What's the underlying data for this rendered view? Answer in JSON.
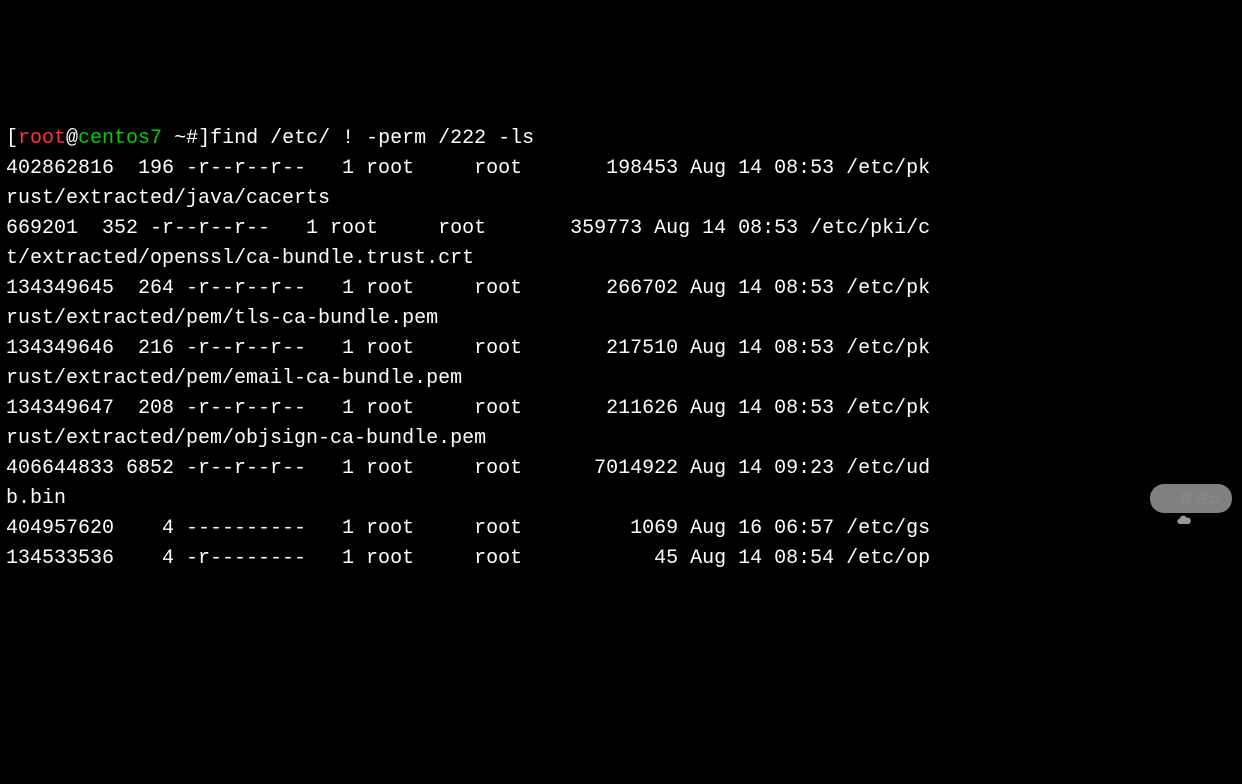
{
  "prompt": {
    "open_bracket": "[",
    "user": "root",
    "at": "@",
    "host": "centos7",
    "space": " ",
    "tilde": "~#",
    "close_bracket": "]",
    "command": "find /etc/ ! -perm /222 -ls"
  },
  "lines": {
    "l1": "402862816  196 -r--r--r--   1 root     root       198453 Aug 14 08:53 /etc/pk",
    "l2": "rust/extracted/java/cacerts",
    "l3": "669201  352 -r--r--r--   1 root     root       359773 Aug 14 08:53 /etc/pki/c",
    "l4": "t/extracted/openssl/ca-bundle.trust.crt",
    "l5": "134349645  264 -r--r--r--   1 root     root       266702 Aug 14 08:53 /etc/pk",
    "l6": "rust/extracted/pem/tls-ca-bundle.pem",
    "l7": "134349646  216 -r--r--r--   1 root     root       217510 Aug 14 08:53 /etc/pk",
    "l8": "rust/extracted/pem/email-ca-bundle.pem",
    "l9": "134349647  208 -r--r--r--   1 root     root       211626 Aug 14 08:53 /etc/pk",
    "l10": "rust/extracted/pem/objsign-ca-bundle.pem",
    "l11": "406644833 6852 -r--r--r--   1 root     root      7014922 Aug 14 09:23 /etc/ud",
    "l12": "b.bin",
    "l13": "404957620    4 ----------   1 root     root         1069 Aug 16 06:57 /etc/gs",
    "l14": "134533536    4 -r--------   1 root     root           45 Aug 14 08:54 /etc/op"
  },
  "watermark": {
    "text": "亿速云"
  }
}
